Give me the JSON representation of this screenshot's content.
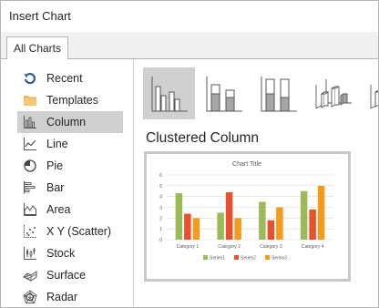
{
  "window": {
    "title": "Insert Chart"
  },
  "tabs": [
    {
      "label": "All Charts"
    }
  ],
  "sidebar": {
    "items": [
      {
        "label": "Recent",
        "icon": "recent-icon"
      },
      {
        "label": "Templates",
        "icon": "folder-icon"
      },
      {
        "label": "Column",
        "icon": "column-chart-icon",
        "selected": true
      },
      {
        "label": "Line",
        "icon": "line-chart-icon"
      },
      {
        "label": "Pie",
        "icon": "pie-chart-icon"
      },
      {
        "label": "Bar",
        "icon": "bar-chart-icon"
      },
      {
        "label": "Area",
        "icon": "area-chart-icon"
      },
      {
        "label": "X Y (Scatter)",
        "icon": "scatter-chart-icon"
      },
      {
        "label": "Stock",
        "icon": "stock-chart-icon"
      },
      {
        "label": "Surface",
        "icon": "surface-chart-icon"
      },
      {
        "label": "Radar",
        "icon": "radar-chart-icon"
      }
    ]
  },
  "subtypes": [
    {
      "name": "clustered-column",
      "selected": true
    },
    {
      "name": "stacked-column"
    },
    {
      "name": "100-stacked-column"
    },
    {
      "name": "3d-clustered-column"
    },
    {
      "name": "3d-column"
    }
  ],
  "main": {
    "subtype_title": "Clustered Column"
  },
  "colors": {
    "series1": "#9bbb59",
    "series2": "#e8502e",
    "series3": "#f79a1a",
    "selected_bg": "#cfcfcf",
    "icon_blue": "#2e5c99",
    "folder": "#e9b85a"
  },
  "chart_data": {
    "type": "bar",
    "title": "Chart Title",
    "categories": [
      "Category 1",
      "Category 2",
      "Category 3",
      "Category 4"
    ],
    "series": [
      {
        "name": "Series1",
        "values": [
          4.3,
          2.5,
          3.5,
          4.5
        ]
      },
      {
        "name": "Series2",
        "values": [
          2.4,
          4.4,
          1.8,
          2.8
        ]
      },
      {
        "name": "Series3",
        "values": [
          2.0,
          2.0,
          3.0,
          5.0
        ]
      }
    ],
    "ylim": [
      0,
      6
    ],
    "yticks": [
      "0",
      "1",
      "2",
      "3",
      "4",
      "5",
      "6"
    ],
    "grid": true,
    "legend": "bottom"
  }
}
